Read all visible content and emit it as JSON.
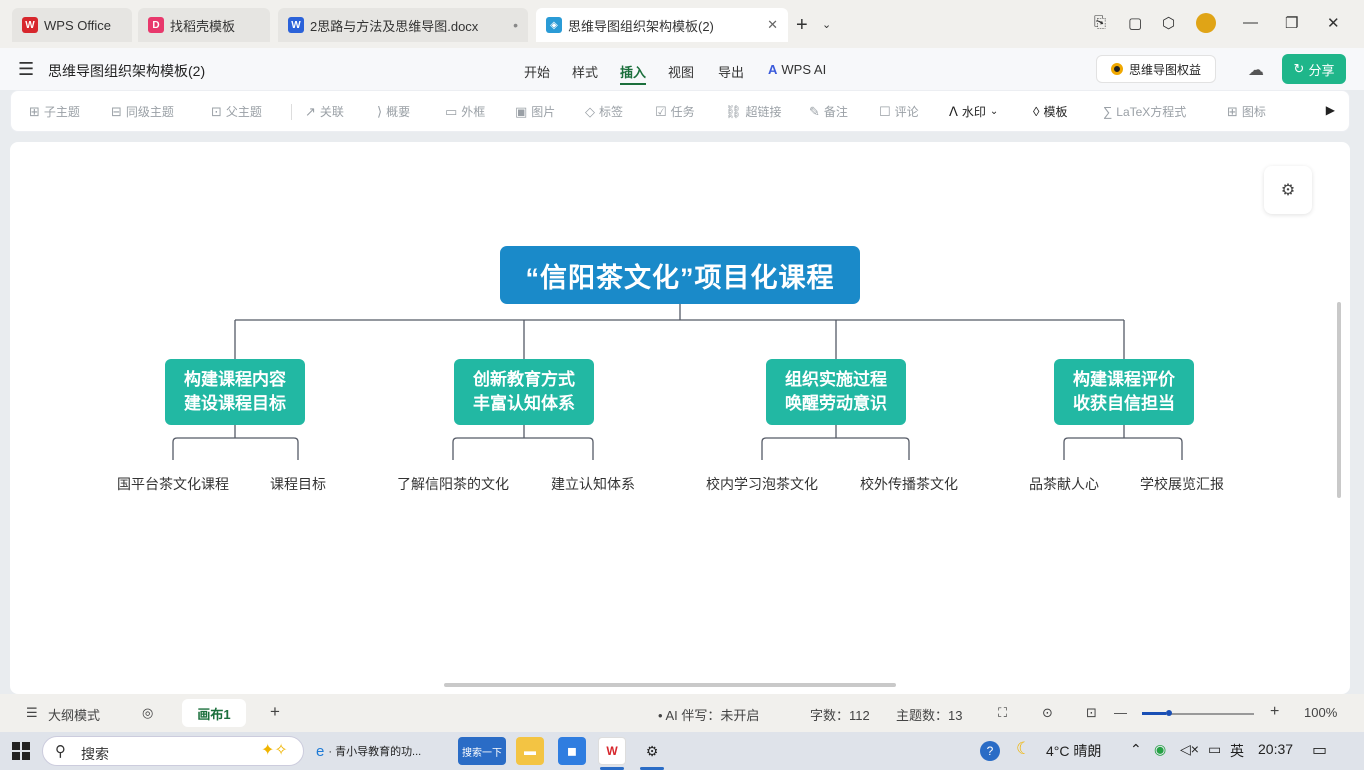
{
  "tabs": [
    {
      "label": "WPS Office",
      "icon": "wps-logo-icon",
      "color": "#d7272d",
      "active": false
    },
    {
      "label": "找稻壳模板",
      "icon": "docer-icon",
      "color": "#e8386c",
      "active": false
    },
    {
      "label": "2思路与方法及思维导图.docx",
      "icon": "word-doc-icon",
      "color": "#2b62d9",
      "active": false
    },
    {
      "label": "思维导图组织架构模板(2)",
      "icon": "mindmap-icon",
      "color": "#2a9bd6",
      "active": true
    }
  ],
  "document_title": "思维导图组织架构模板(2)",
  "menu": {
    "items": [
      "开始",
      "样式",
      "插入",
      "视图",
      "导出"
    ],
    "active": "插入",
    "ai_label": "WPS AI",
    "rights_label": "思维导图权益",
    "share_label": "分享"
  },
  "toolbar": [
    {
      "label": "子主题",
      "icon": "subtopic-icon",
      "enabled": false
    },
    {
      "label": "同级主题",
      "icon": "sibling-topic-icon",
      "enabled": false
    },
    {
      "label": "父主题",
      "icon": "parent-topic-icon",
      "enabled": false
    },
    {
      "label": "关联",
      "icon": "relation-icon",
      "enabled": false
    },
    {
      "label": "概要",
      "icon": "summary-icon",
      "enabled": false
    },
    {
      "label": "外框",
      "icon": "boundary-icon",
      "enabled": false
    },
    {
      "label": "图片",
      "icon": "image-icon",
      "enabled": false
    },
    {
      "label": "标签",
      "icon": "tag-icon",
      "enabled": false
    },
    {
      "label": "任务",
      "icon": "task-icon",
      "enabled": false
    },
    {
      "label": "超链接",
      "icon": "link-icon",
      "enabled": false
    },
    {
      "label": "备注",
      "icon": "note-icon",
      "enabled": false
    },
    {
      "label": "评论",
      "icon": "comment-icon",
      "enabled": false
    },
    {
      "label": "水印",
      "icon": "watermark-icon",
      "enabled": true
    },
    {
      "label": "模板",
      "icon": "template-icon",
      "enabled": true
    },
    {
      "label": "LaTeX方程式",
      "icon": "latex-icon",
      "enabled": false
    },
    {
      "label": "图标",
      "icon": "icon-library-icon",
      "enabled": false
    }
  ],
  "mindmap": {
    "root": "“信阳茶文化”项目化课程",
    "branches": [
      {
        "line1": "构建课程内容",
        "line2": "建设课程目标",
        "leaves": [
          "国平台茶文化课程",
          "课程目标"
        ]
      },
      {
        "line1": "创新教育方式",
        "line2": "丰富认知体系",
        "leaves": [
          "了解信阳茶的文化",
          "建立认知体系"
        ]
      },
      {
        "line1": "组织实施过程",
        "line2": "唤醒劳动意识",
        "leaves": [
          "校内学习泡茶文化",
          "校外传播茶文化"
        ]
      },
      {
        "line1": "构建课程评价",
        "line2": "收获自信担当",
        "leaves": [
          "品茶献人心",
          "学校展览汇报"
        ]
      }
    ],
    "root_color": "#1a8ac9",
    "branch_color": "#22b8a3",
    "line_color": "#555a66"
  },
  "status": {
    "outline_mode": "大纲模式",
    "canvas_tab": "画布1",
    "ai_writing": "AI 伴写：未开启",
    "char_count_label": "字数：112",
    "topic_count_label": "主题数：13",
    "zoom": "100%",
    "zoom_level": 0.2
  },
  "taskbar": {
    "search_placeholder": "搜索",
    "browser_label": "· 青小导教育的功...",
    "search_app_label": "搜索一下",
    "weather": "4°C 晴朗",
    "ime": "英",
    "time": "20:37"
  }
}
